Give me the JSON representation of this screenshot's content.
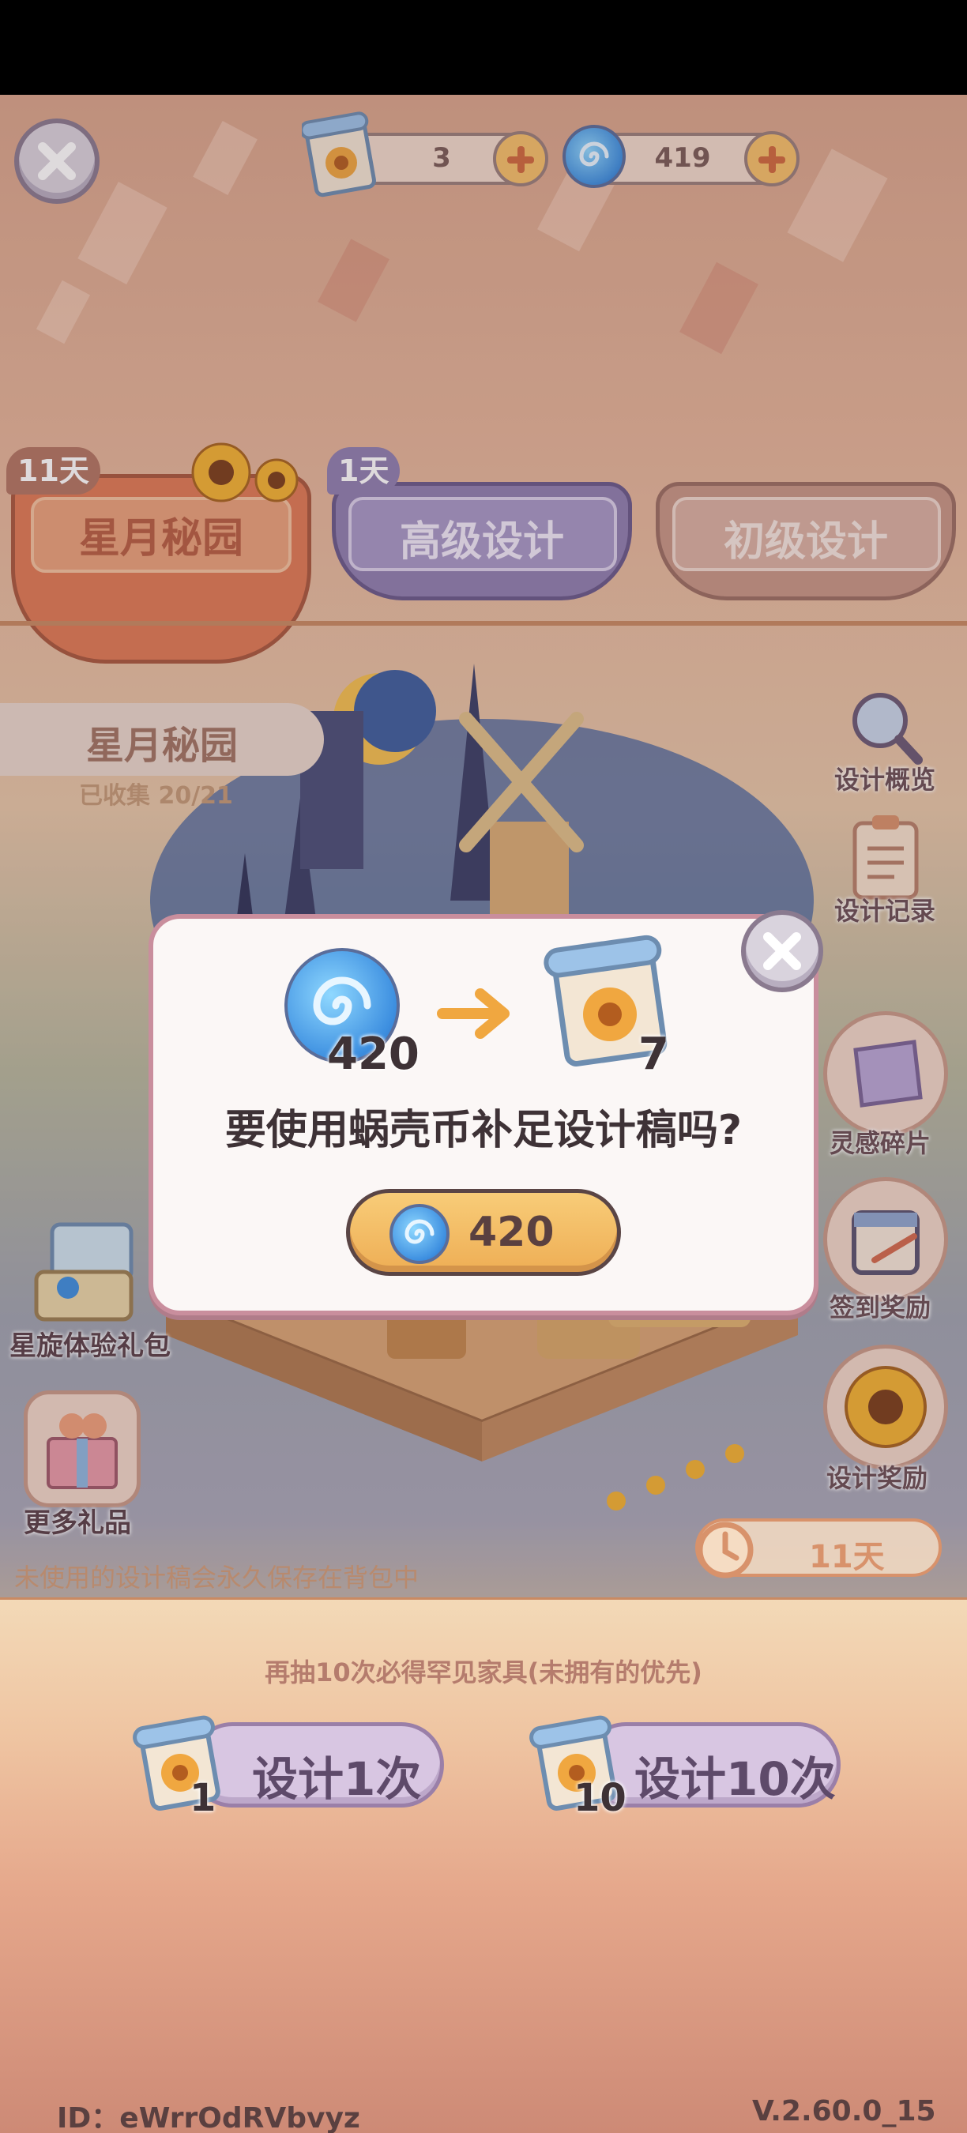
{
  "header": {
    "scroll_count": "3",
    "coin_count": "419"
  },
  "tabs": [
    {
      "label": "星月秘园",
      "days": "11天",
      "active": true
    },
    {
      "label": "高级设计",
      "days": "1天",
      "active": false
    },
    {
      "label": "初级设计",
      "days": "",
      "active": false
    }
  ],
  "collection": {
    "name": "星月秘园",
    "collected": "已收集 20/21"
  },
  "side_menu": [
    {
      "label": "设计概览",
      "icon": "magnifier-icon"
    },
    {
      "label": "设计记录",
      "icon": "clipboard-icon"
    },
    {
      "label": "灵感碎片",
      "icon": "inspiration-fragment-icon"
    },
    {
      "label": "签到奖励",
      "icon": "calendar-icon"
    },
    {
      "label": "设计奖励",
      "icon": "sunflower-icon"
    }
  ],
  "gifts": [
    {
      "label": "星旋体验礼包",
      "icon": "gift-pack-icon"
    },
    {
      "label": "更多礼品",
      "icon": "gift-box-icon"
    }
  ],
  "modal": {
    "cost_coins": "420",
    "result_scrolls": "7",
    "question": "要使用蜗壳币补足设计稿吗?",
    "confirm_value": "420"
  },
  "footer": {
    "save_note": "未使用的设计稿会永久保存在背包中",
    "timer_days": "11天",
    "guarantee": "再抽10次必得罕见家具(未拥有的优先)",
    "draw_once_label": "设计1次",
    "draw_once_cost": "1",
    "draw_ten_label": "设计10次",
    "draw_ten_cost": "10",
    "player_id": "ID：eWrrOdRVbvyz",
    "version": "V.2.60.0_15"
  },
  "colors": {
    "accent_orange": "#e07a55",
    "coin_blue": "#3d8fe0",
    "purple_tab": "#8f7fb0",
    "button_gold": "#f2b75f"
  }
}
